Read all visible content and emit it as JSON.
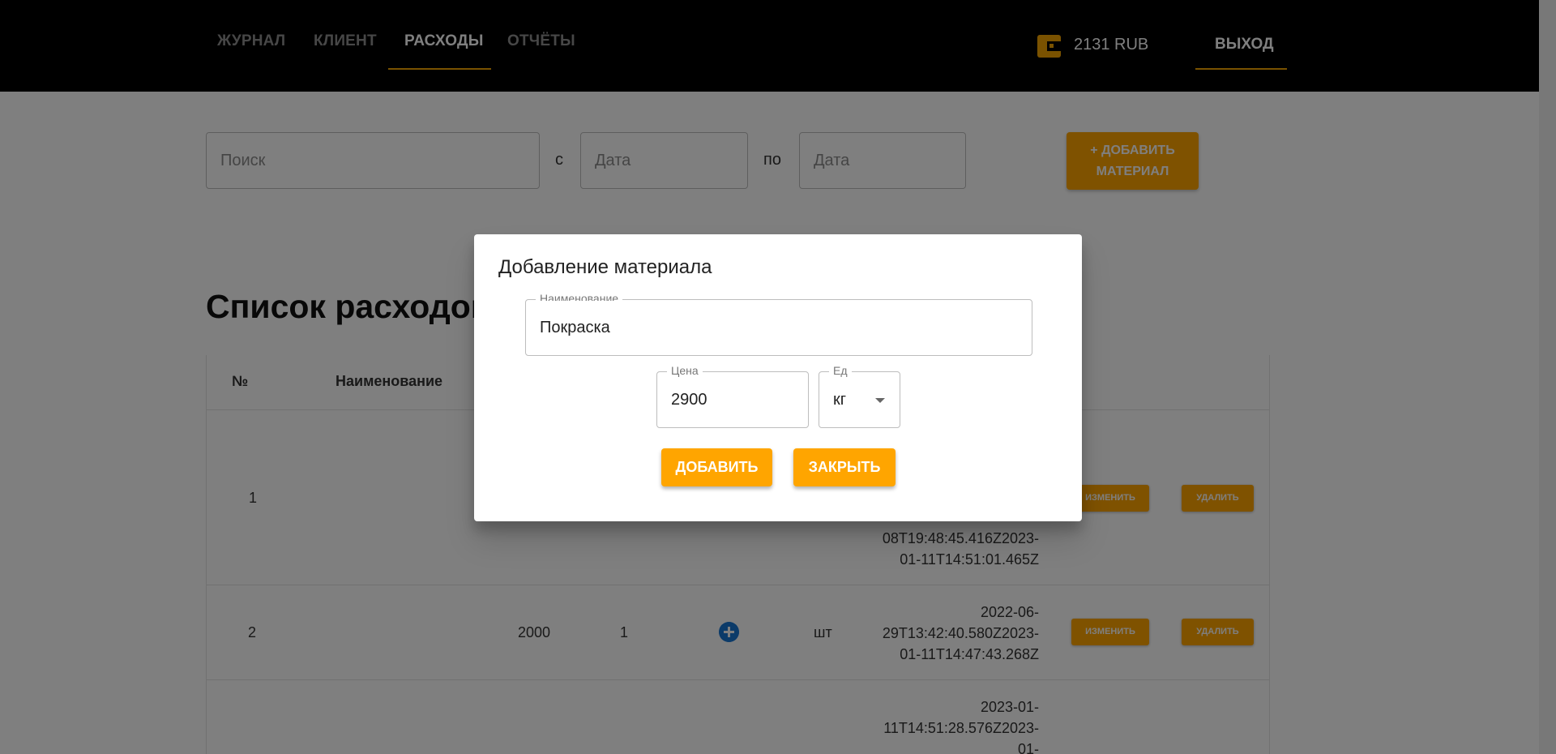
{
  "nav": {
    "items": [
      {
        "label": "ЖУРНАЛ"
      },
      {
        "label": "КЛИЕНТ"
      },
      {
        "label": "РАСХОДЫ"
      },
      {
        "label": "ОТЧЁТЫ"
      }
    ],
    "active": "РАСХОДЫ",
    "balance": "2131 RUB",
    "logout_label": "ВЫХОД"
  },
  "filters": {
    "search_placeholder": "Поиск",
    "from_label": "с",
    "from_placeholder": "Дата",
    "to_label": "по",
    "to_placeholder": "Дата",
    "add_button_line1": "+ ДОБАВИТЬ",
    "add_button_line2": "МАТЕРИАЛ"
  },
  "list": {
    "title": "Список расходов",
    "headers": {
      "num": "№",
      "name": "Наименование"
    },
    "rows": [
      {
        "num": "1",
        "dates": [
          "08T19:48:45.416Z2023-",
          "01-11T14:51:01.465Z"
        ],
        "edit": "ИЗМЕНИТЬ",
        "delete": "УДАЛИТЬ"
      },
      {
        "num": "2",
        "price": "2000",
        "qty": "1",
        "unit": "шт",
        "dates": [
          "2022-06-",
          "29T13:42:40.580Z2023-",
          "01-11T14:47:43.268Z"
        ],
        "edit": "ИЗМЕНИТЬ",
        "delete": "УДАЛИТЬ"
      },
      {
        "dates": [
          "2023-01-",
          "11T14:51:28.576Z2023-",
          "01-"
        ]
      }
    ]
  },
  "dialog": {
    "title": "Добавление материала",
    "name_label": "Наименование",
    "name_value": "Покраска",
    "price_label": "Цена",
    "price_value": "2900",
    "unit_label": "Ед",
    "unit_value": "кг",
    "add_label": "ДОБАВИТЬ",
    "close_label": "ЗАКРЫТЬ"
  },
  "colors": {
    "accent": "#ffa500",
    "topbar": "#000000",
    "plus_icon": "#1976d2"
  }
}
